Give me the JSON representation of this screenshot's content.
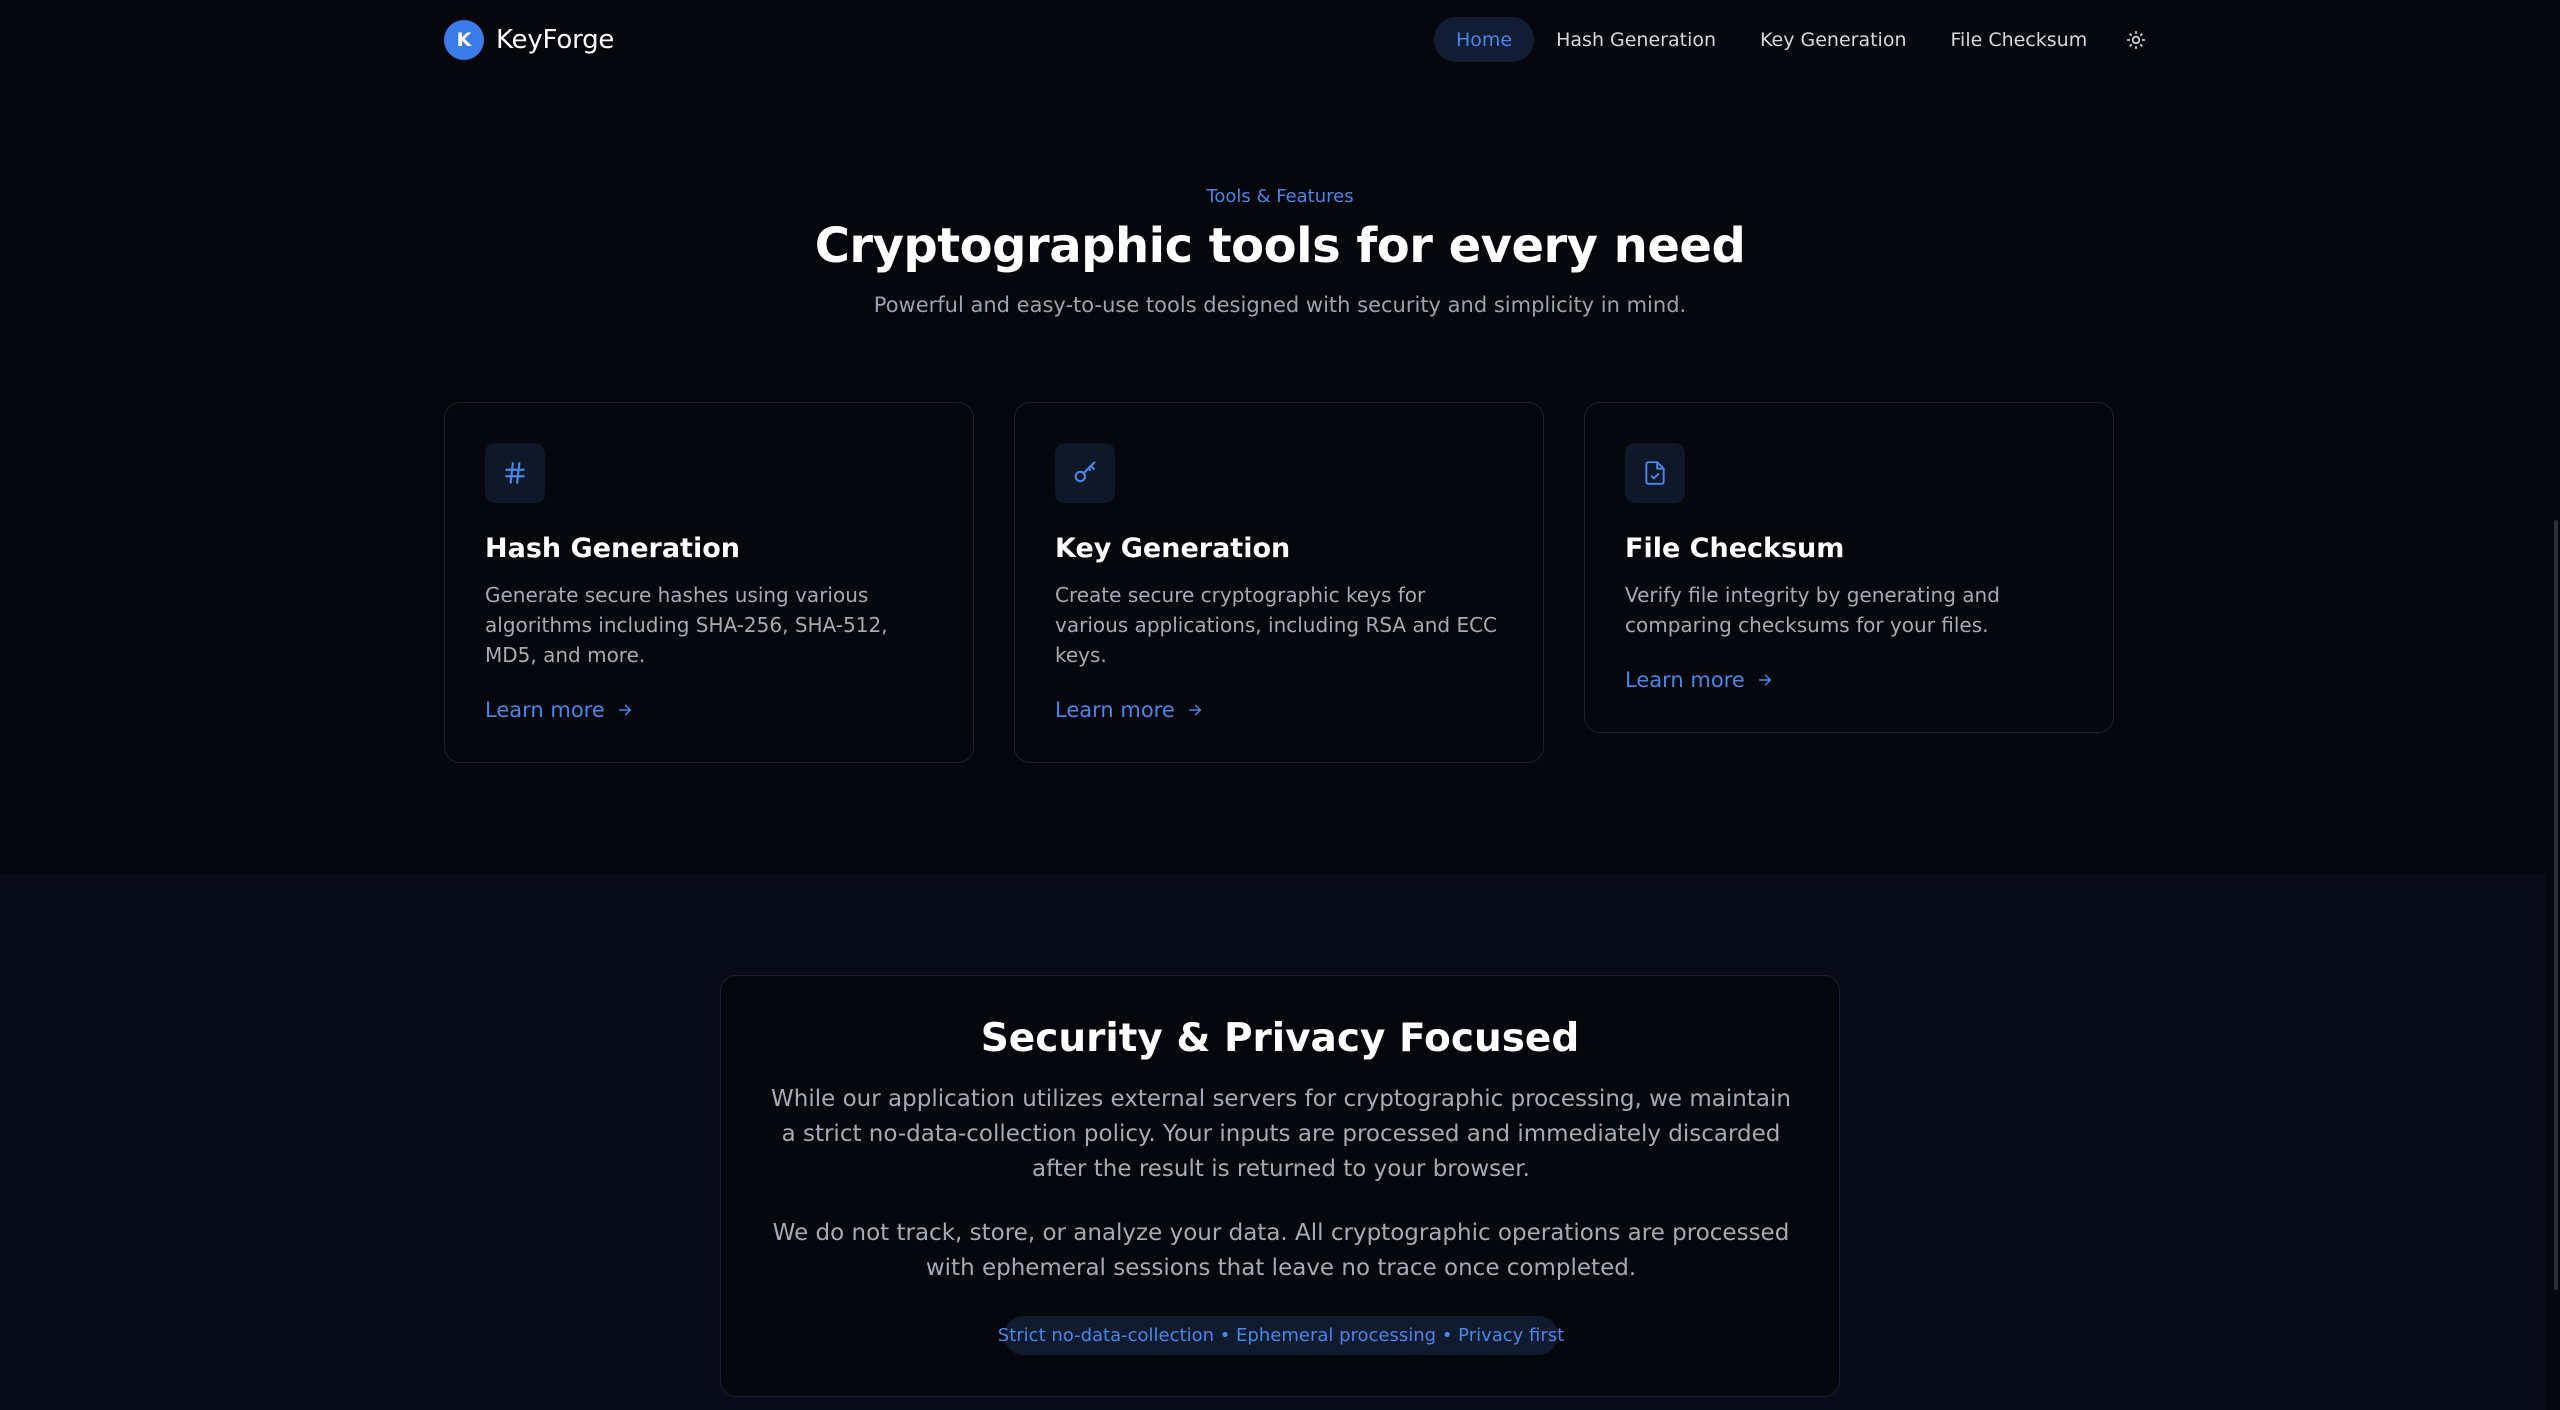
{
  "brand": {
    "logo_letter": "K",
    "name": "KeyForge"
  },
  "nav": {
    "items": [
      {
        "label": "Home",
        "active": true
      },
      {
        "label": "Hash Generation",
        "active": false
      },
      {
        "label": "Key Generation",
        "active": false
      },
      {
        "label": "File Checksum",
        "active": false
      }
    ],
    "theme_toggle_icon": "sun-icon"
  },
  "hero": {
    "eyebrow": "Tools & Features",
    "title": "Cryptographic tools for every need",
    "subtitle": "Powerful and easy-to-use tools designed with security and simplicity in mind."
  },
  "features": [
    {
      "icon": "hash-icon",
      "title": "Hash Generation",
      "description": "Generate secure hashes using various algorithms including SHA-256, SHA-512, MD5, and more.",
      "link": "Learn more"
    },
    {
      "icon": "key-icon",
      "title": "Key Generation",
      "description": "Create secure cryptographic keys for various applications, including RSA and ECC keys.",
      "link": "Learn more"
    },
    {
      "icon": "file-check-icon",
      "title": "File Checksum",
      "description": "Verify file integrity by generating and comparing checksums for your files.",
      "link": "Learn more"
    }
  ],
  "privacy": {
    "title": "Security & Privacy Focused",
    "paragraph1": "While our application utilizes external servers for cryptographic processing, we maintain a strict no-data-collection policy. Your inputs are processed and immediately discarded after the result is returned to your browser.",
    "paragraph2": "We do not track, store, or analyze your data. All cryptographic operations are processed with ephemeral sessions that leave no trace once completed.",
    "badge": "Strict no-data-collection • Ephemeral processing • Privacy first"
  },
  "colors": {
    "accent": "#4a86e8",
    "background": "#05070c",
    "section_background": "#070c18"
  }
}
